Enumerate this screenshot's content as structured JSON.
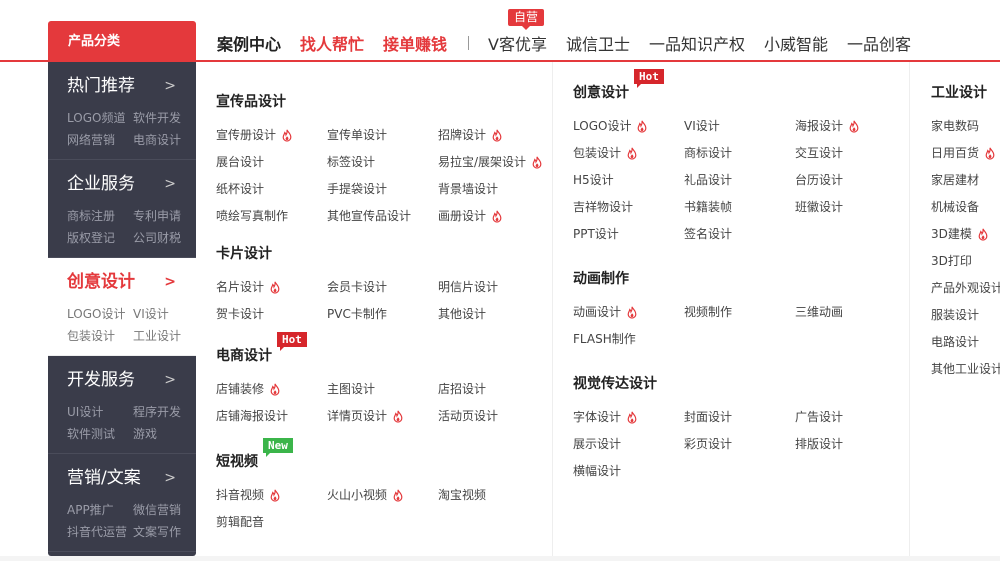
{
  "nav": {
    "category_header": "产品分类",
    "items": [
      {
        "label": "案例中心",
        "style": "bold"
      },
      {
        "label": "找人帮忙",
        "style": "red"
      },
      {
        "label": "接单赚钱",
        "style": "red"
      }
    ],
    "items_after": [
      {
        "label": "V客优享",
        "badge": "自营"
      },
      {
        "label": "诚信卫士"
      },
      {
        "label": "一品知识产权"
      },
      {
        "label": "小威智能"
      },
      {
        "label": "一品创客"
      }
    ],
    "separator": "|"
  },
  "sidebar": [
    {
      "title": "热门推荐",
      "arrow": ">",
      "links": [
        "LOGO频道",
        "软件开发",
        "网络营销",
        "电商设计"
      ]
    },
    {
      "title": "企业服务",
      "arrow": ">",
      "links": [
        "商标注册",
        "专利申请",
        "版权登记",
        "公司财税"
      ]
    },
    {
      "title": "创意设计",
      "arrow": ">",
      "active": true,
      "links": [
        "LOGO设计",
        "VI设计",
        "包装设计",
        "工业设计"
      ]
    },
    {
      "title": "开发服务",
      "arrow": ">",
      "links": [
        "UI设计",
        "程序开发",
        "软件测试",
        "游戏"
      ]
    },
    {
      "title": "营销/文案",
      "arrow": ">",
      "links": [
        "APP推广",
        "微信营销",
        "抖音代运营",
        "文案写作"
      ]
    }
  ],
  "columns": [
    [
      {
        "title": "宣传品设计",
        "top": 0,
        "items": [
          {
            "label": "宣传册设计",
            "hot": true
          },
          {
            "label": "宣传单设计"
          },
          {
            "label": "招牌设计",
            "hot": true
          },
          {
            "label": "展台设计"
          },
          {
            "label": "标签设计"
          },
          {
            "label": "易拉宝/展架设计",
            "hot": true
          },
          {
            "label": "纸杯设计"
          },
          {
            "label": "手提袋设计"
          },
          {
            "label": "背景墙设计"
          },
          {
            "label": "喷绘写真制作"
          },
          {
            "label": "其他宣传品设计"
          },
          {
            "label": "画册设计",
            "hot": true
          }
        ]
      },
      {
        "title": "卡片设计",
        "items": [
          {
            "label": "名片设计",
            "hot": true
          },
          {
            "label": "会员卡设计"
          },
          {
            "label": "明信片设计"
          },
          {
            "label": "贺卡设计"
          },
          {
            "label": "PVC卡制作"
          },
          {
            "label": "其他设计"
          }
        ]
      },
      {
        "title": "电商设计",
        "tag": "Hot",
        "tag_type": "hot",
        "items": [
          {
            "label": "店铺装修",
            "hot": true
          },
          {
            "label": "主图设计"
          },
          {
            "label": "店招设计"
          },
          {
            "label": "店铺海报设计"
          },
          {
            "label": "详情页设计",
            "hot": true
          },
          {
            "label": "活动页设计"
          }
        ]
      },
      {
        "title": "短视频",
        "tag": "New",
        "tag_type": "new",
        "items": [
          {
            "label": "抖音视频",
            "hot": true
          },
          {
            "label": "火山小视频",
            "hot": true
          },
          {
            "label": "淘宝视频"
          },
          {
            "label": "剪辑配音"
          }
        ]
      }
    ],
    [
      {
        "title": "创意设计",
        "tag": "Hot",
        "tag_type": "hot",
        "items": [
          {
            "label": "LOGO设计",
            "hot": true
          },
          {
            "label": "VI设计"
          },
          {
            "label": "海报设计",
            "hot": true
          },
          {
            "label": "包装设计",
            "hot": true
          },
          {
            "label": "商标设计"
          },
          {
            "label": "交互设计"
          },
          {
            "label": "H5设计"
          },
          {
            "label": "礼品设计"
          },
          {
            "label": "台历设计"
          },
          {
            "label": "吉祥物设计"
          },
          {
            "label": "书籍装帧"
          },
          {
            "label": "班徽设计"
          },
          {
            "label": "PPT设计"
          },
          {
            "label": "签名设计"
          }
        ]
      },
      {
        "title": "动画制作",
        "items": [
          {
            "label": "动画设计",
            "hot": true
          },
          {
            "label": "视频制作"
          },
          {
            "label": "三维动画"
          },
          {
            "label": "FLASH制作"
          }
        ]
      },
      {
        "title": "视觉传达设计",
        "items": [
          {
            "label": "字体设计",
            "hot": true
          },
          {
            "label": "封面设计"
          },
          {
            "label": "广告设计"
          },
          {
            "label": "展示设计"
          },
          {
            "label": "彩页设计"
          },
          {
            "label": "排版设计"
          },
          {
            "label": "横幅设计"
          }
        ]
      }
    ],
    [
      {
        "title": "工业设计",
        "items": [
          {
            "label": "家电数码"
          },
          {
            "label": "日用百货",
            "hot": true
          },
          {
            "label": "家居建材"
          },
          {
            "label": "机械设备"
          },
          {
            "label": "3D建模",
            "hot": true
          },
          {
            "label": "3D打印"
          },
          {
            "label": "产品外观设计"
          },
          {
            "label": "服装设计"
          },
          {
            "label": "电路设计"
          },
          {
            "label": "其他工业设计"
          }
        ]
      }
    ]
  ]
}
